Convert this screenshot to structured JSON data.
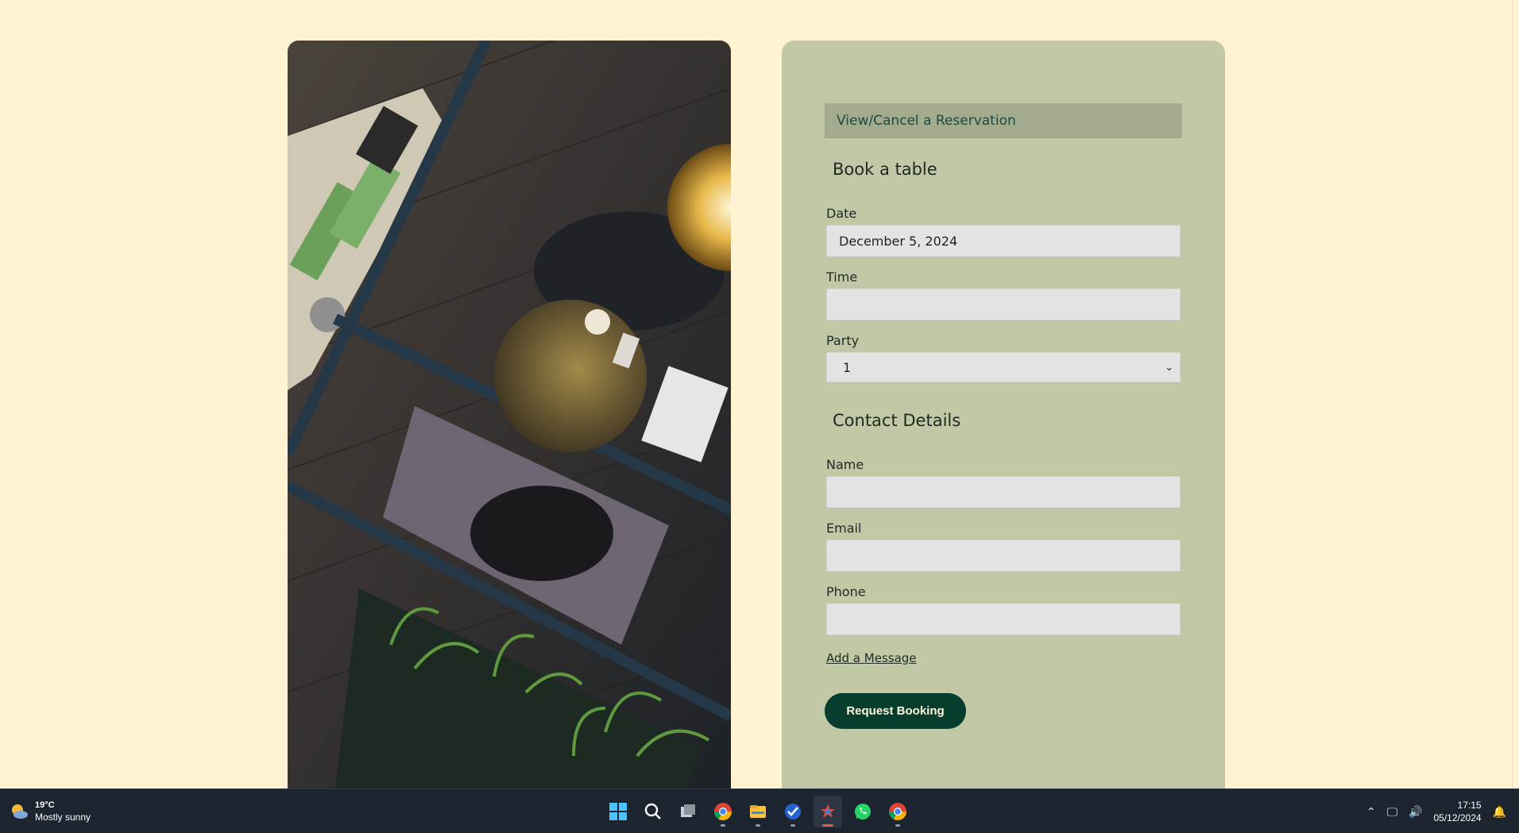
{
  "booking": {
    "view_cancel_label": "View/Cancel a Reservation",
    "book_title": "Book a table",
    "date_label": "Date",
    "date_value": "December 5, 2024",
    "time_label": "Time",
    "time_value": "",
    "party_label": "Party",
    "party_value": "1",
    "contact_title": "Contact Details",
    "name_label": "Name",
    "email_label": "Email",
    "phone_label": "Phone",
    "add_message_label": "Add a Message",
    "request_label": "Request Booking"
  },
  "taskbar": {
    "weather_temp": "19°C",
    "weather_desc": "Mostly sunny",
    "apps": [
      {
        "name": "start",
        "icon": "windows-icon"
      },
      {
        "name": "search",
        "icon": "search-icon"
      },
      {
        "name": "task-view",
        "icon": "task-view-icon"
      },
      {
        "name": "chrome",
        "icon": "chrome-icon"
      },
      {
        "name": "file-explorer",
        "icon": "folder-icon"
      },
      {
        "name": "todo",
        "icon": "checkmark-icon"
      },
      {
        "name": "active-app",
        "icon": "app-icon"
      },
      {
        "name": "whatsapp",
        "icon": "whatsapp-icon"
      },
      {
        "name": "chrome-profile",
        "icon": "chrome-icon"
      }
    ],
    "time": "17:15",
    "date": "05/12/2024"
  },
  "colors": {
    "page_bg": "#fff3d2",
    "panel_bg": "#c2c8a6",
    "button_bg": "#073d2d",
    "taskbar_bg": "#1c2430"
  }
}
